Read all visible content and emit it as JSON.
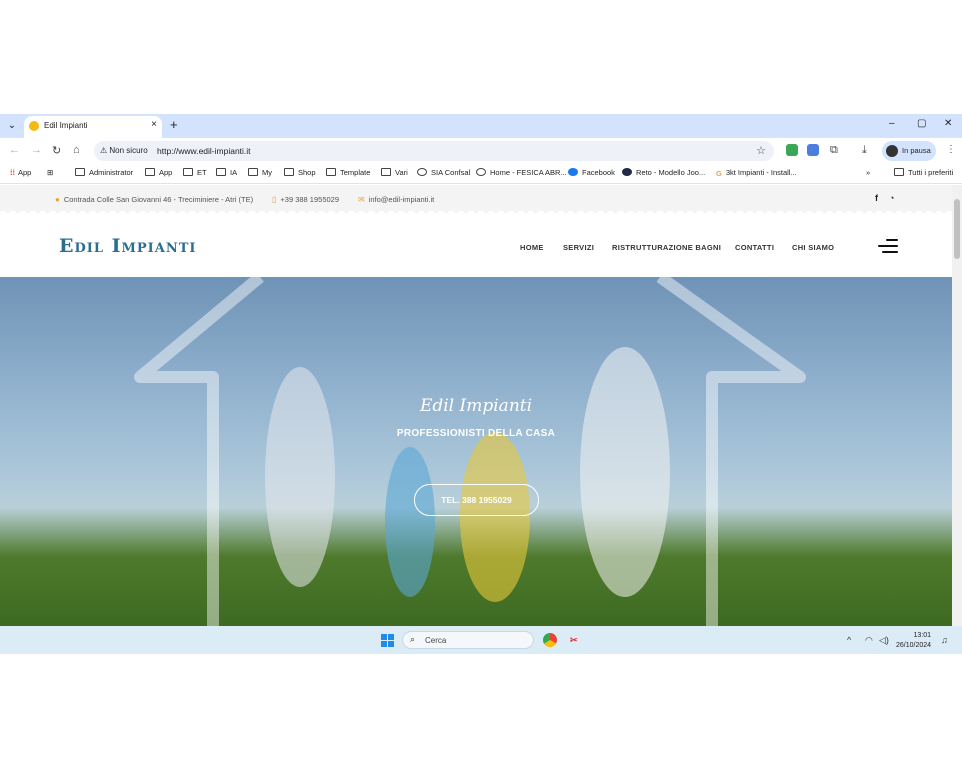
{
  "browser": {
    "tab_title": "Edil Impianti",
    "new_tab": "+",
    "security_label": "Non sicuro",
    "url": "http://www.edil-impianti.it",
    "profile_label": "In pausa",
    "window_controls": {
      "minimize": "–",
      "maximize": "▢",
      "close": "✕"
    }
  },
  "bookmarks": {
    "apps": "App",
    "items": [
      "Administrator",
      "App",
      "ET",
      "IA",
      "My",
      "Shop",
      "Template",
      "Vari",
      "SIA Confsal",
      "Home - FESICA ABR...",
      "Facebook",
      "Reto - Modello Joo...",
      "3kt Impianti - Install..."
    ],
    "more": "»",
    "all_bookmarks": "Tutti i preferiti"
  },
  "site": {
    "topbar": {
      "address": "Contrada Colle San Giovanni 46 - Treciminiere - Atri (TE)",
      "phone": "+39 388 1955029",
      "email": "info@edil-impianti.it",
      "facebook": "f",
      "whatsapp": "◔"
    },
    "logo": "Edil Impianti",
    "menu": [
      "HOME",
      "SERVIZI",
      "RISTRUTTURAZIONE BAGNI",
      "CONTATTI",
      "CHI SIAMO"
    ],
    "hero": {
      "title": "Edil Impianti",
      "subtitle": "PROFESSIONISTI DELLA CASA",
      "cta": "TEL. 388 1955029"
    }
  },
  "taskbar": {
    "search_label": "Cerca",
    "time": "13:01",
    "date": "26/10/2024"
  },
  "colors": {
    "logo": "#2c6e8f",
    "accent": "#e8a33a",
    "tab_strip": "#d3e3fd",
    "taskbar": "#dcecf7"
  }
}
